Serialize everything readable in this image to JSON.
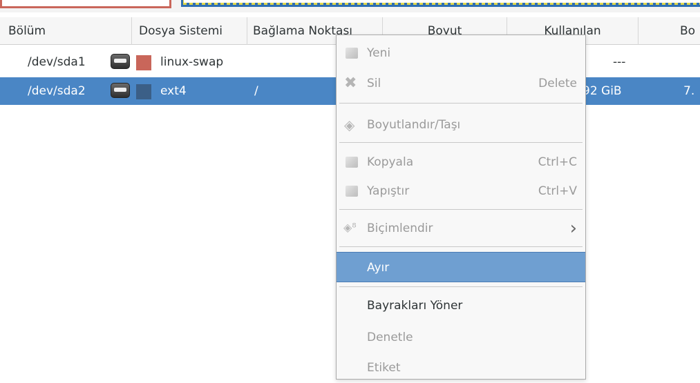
{
  "columns": {
    "partition": "Bölüm",
    "filesystem": "Dosya Sistemi",
    "mountpoint": "Bağlama Noktası",
    "size": "Boyut",
    "used": "Kullanılan",
    "unused": "Bo"
  },
  "rows": [
    {
      "partition": "/dev/sda1",
      "filesystem": "linux-swap",
      "mountpoint": "",
      "used": "---",
      "unused": "",
      "color": "#c9665a"
    },
    {
      "partition": "/dev/sda2",
      "filesystem": "ext4",
      "mountpoint": "/",
      "used": "92 GiB",
      "unused": "7.",
      "color": "#3b5f87"
    }
  ],
  "menu": {
    "new": "Yeni",
    "delete": "Sil",
    "delete_shortcut": "Delete",
    "resize": "Boyutlandır/Taşı",
    "copy": "Kopyala",
    "copy_shortcut": "Ctrl+C",
    "paste": "Yapıştır",
    "paste_shortcut": "Ctrl+V",
    "format": "Biçimlendir",
    "unmount": "Ayır",
    "manage_flags": "Bayrakları Yöner",
    "check": "Denetle",
    "label": "Etiket"
  },
  "colors": {
    "selection": "#4a86c5",
    "menu_highlight": "#6f9fd1",
    "swap": "#c9665a",
    "ext4": "#3b5f87"
  }
}
